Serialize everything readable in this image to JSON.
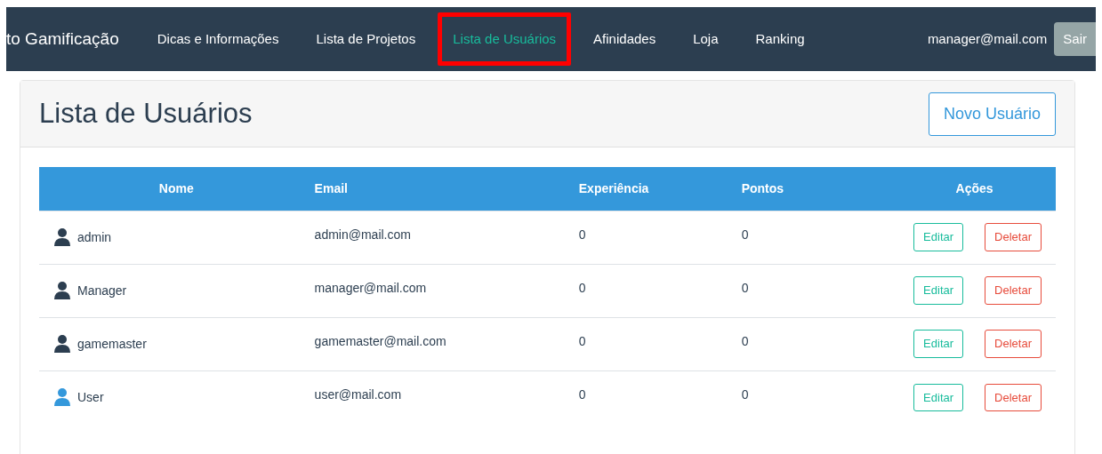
{
  "navbar": {
    "brand": "to Gamificação",
    "items": [
      {
        "label": "Dicas e Informações",
        "selected": false,
        "highlight": false
      },
      {
        "label": "Lista de Projetos",
        "selected": false,
        "highlight": false
      },
      {
        "label": "Lista de Usuários",
        "selected": true,
        "highlight": true
      },
      {
        "label": "Afinidades",
        "selected": false,
        "highlight": false
      },
      {
        "label": "Loja",
        "selected": false,
        "highlight": false
      },
      {
        "label": "Ranking",
        "selected": false,
        "highlight": false
      }
    ],
    "user_email": "manager@mail.com",
    "logout_button": "Sair"
  },
  "card": {
    "title": "Lista de Usuários",
    "new_button": "Novo Usuário"
  },
  "table": {
    "columns": [
      "Nome",
      "Email",
      "Experiência",
      "Pontos",
      "Ações"
    ],
    "rows": [
      {
        "name": "admin",
        "color": "#2c3e50",
        "email": "admin@mail.com",
        "experience": "0",
        "points": "0",
        "edit": "Editar",
        "delete": "Deletar"
      },
      {
        "name": "Manager",
        "color": "#2c3e50",
        "email": "manager@mail.com",
        "experience": "0",
        "points": "0",
        "edit": "Editar",
        "delete": "Deletar"
      },
      {
        "name": "gamemaster",
        "color": "#2c3e50",
        "email": "gamemaster@mail.com",
        "experience": "0",
        "points": "0",
        "edit": "Editar",
        "delete": "Deletar"
      },
      {
        "name": "User",
        "color": "#3498db",
        "email": "user@mail.com",
        "experience": "0",
        "points": "0",
        "edit": "Editar",
        "delete": "Deletar"
      }
    ]
  }
}
